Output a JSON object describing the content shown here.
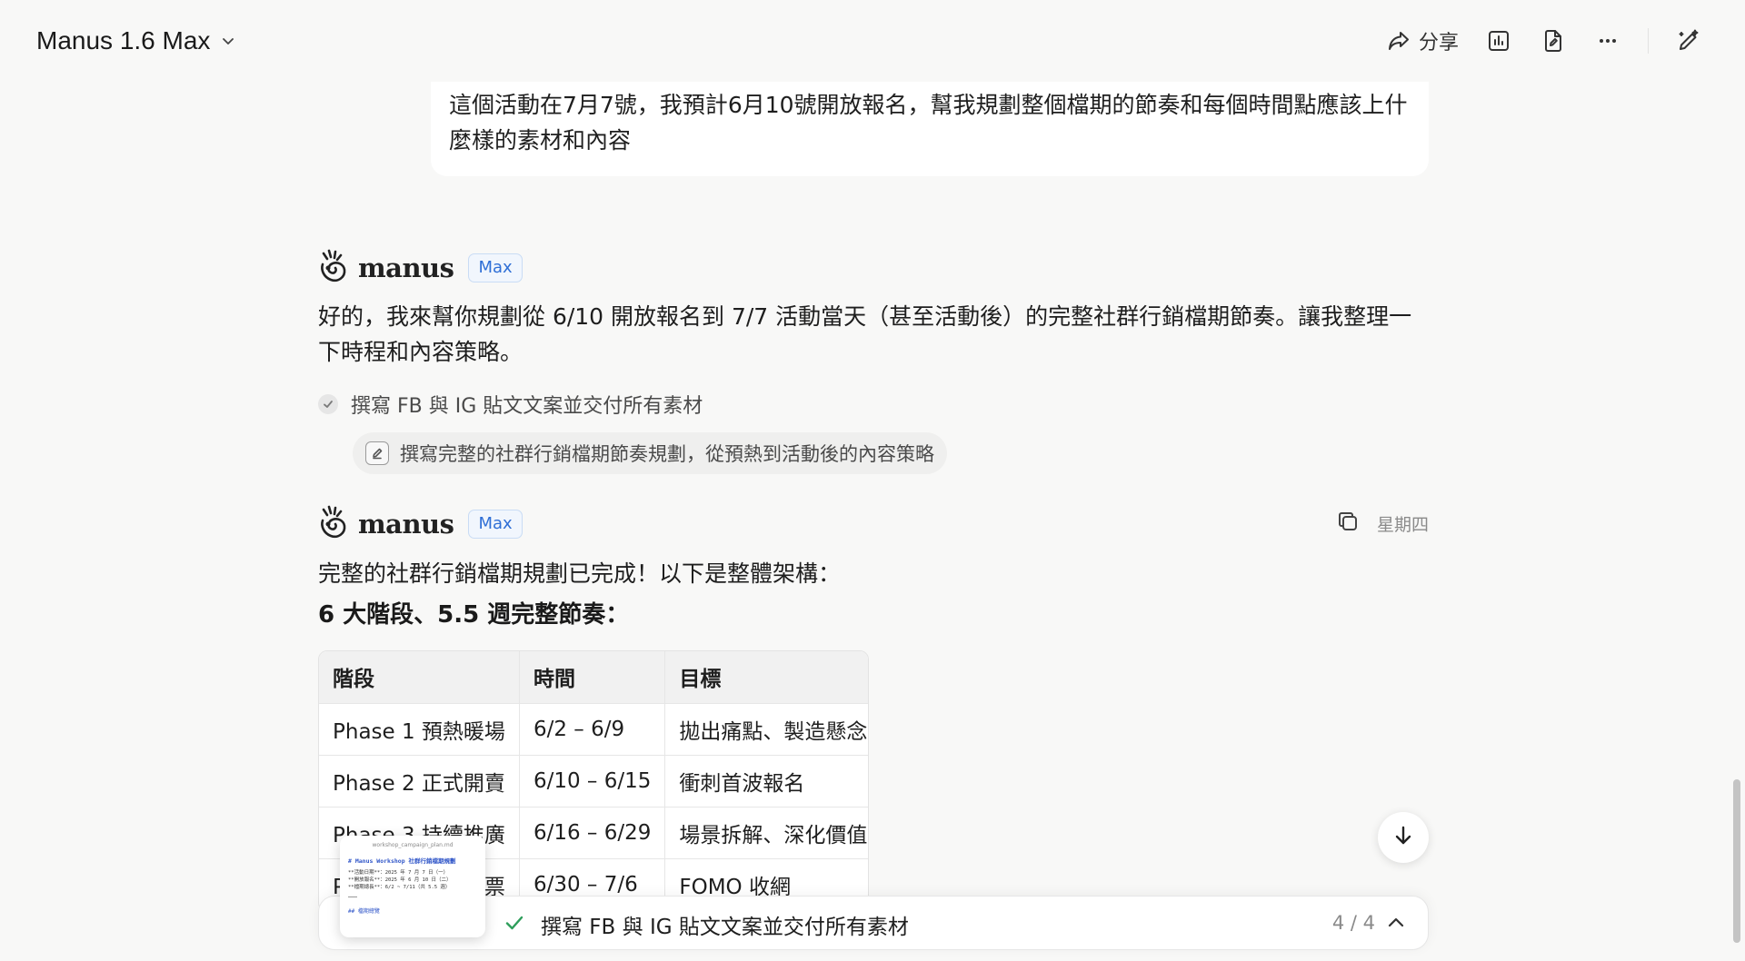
{
  "header": {
    "model_name": "Manus 1.6 Max",
    "share_label": "分享"
  },
  "user_message": {
    "text": "這個活動在7月7號，我預計6月10號開放報名，幫我規劃整個檔期的節奏和每個時間點應該上什麼樣的素材和內容"
  },
  "agent": {
    "name": "manus",
    "badge": "Max"
  },
  "reply1": {
    "text": "好的，我來幫你規劃從 6/10 開放報名到 7/7 活動當天（甚至活動後）的完整社群行銷檔期節奏。讓我整理一下時程和內容策略。",
    "step": "撰寫 FB 與 IG 貼文文案並交付所有素材",
    "tool_action": "撰寫完整的社群行銷檔期節奏規劃，從預熱到活動後的內容策略"
  },
  "reply2": {
    "day": "星期四",
    "intro": "完整的社群行銷檔期規劃已完成！以下是整體架構：",
    "subhead": "6 大階段、5.5 週完整節奏：",
    "table": {
      "headers": [
        "階段",
        "時間",
        "目標"
      ],
      "rows": [
        [
          "Phase 1 預熱暖場",
          "6/2 – 6/9",
          "拋出痛點、製造懸念"
        ],
        [
          "Phase 2 正式開賣",
          "6/10 – 6/15",
          "衝刺首波報名"
        ],
        [
          "Phase 3 持續推廣",
          "6/16 – 6/29",
          "場景拆解、深化價值"
        ],
        [
          "Phase 4 最後衝票",
          "6/30 – 7/6",
          "FOMO 收網"
        ]
      ]
    }
  },
  "file_preview": {
    "filename": "workshop_campaign_plan.md",
    "heading": "# Manus Workshop 社群行銷檔期規劃",
    "lines": [
      "**活動日期**：2025 年 7 月 7 日（一）",
      "**開放報名**：2025 年 6 月 10 日（二）",
      "**檔期總長**：6/2 ~ 7/11（共 5.5 週）"
    ],
    "subheading": "## 檔期總覽"
  },
  "task_bar": {
    "text": "撰寫 FB 與 IG 貼文文案並交付所有素材",
    "progress": "4 / 4"
  },
  "colors": {
    "accent_blue": "#2f6fd6",
    "check_green": "#2e9e5b",
    "background": "#f8f8f7"
  },
  "icons": [
    "chevron-down-icon",
    "share-icon",
    "chart-icon",
    "file-edit-icon",
    "more-icon",
    "pen-sparkle-icon",
    "manus-logo-icon",
    "check-icon",
    "edit-icon",
    "copy-icon",
    "arrow-down-icon",
    "chevron-up-icon"
  ]
}
